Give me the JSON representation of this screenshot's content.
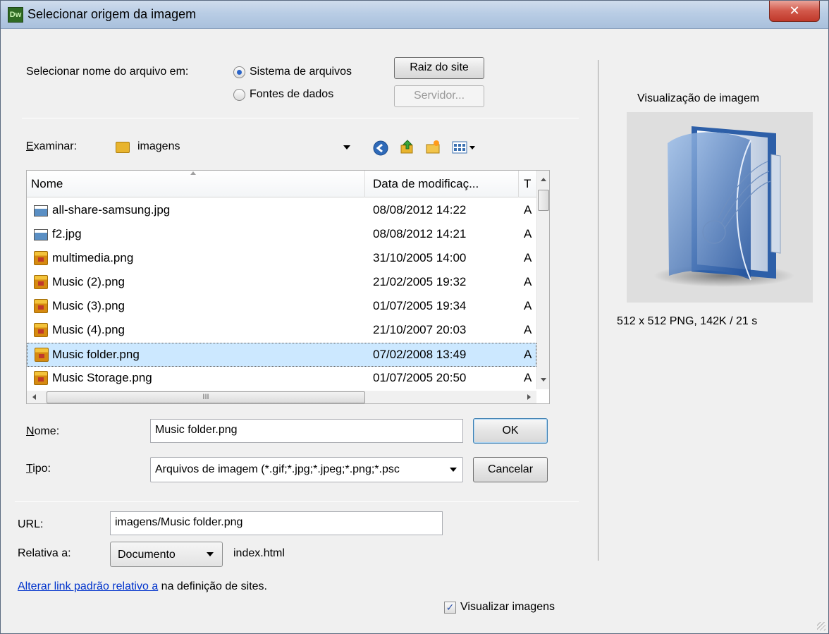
{
  "window": {
    "title": "Selecionar origem da imagem",
    "app_icon_text": "Dw",
    "close_glyph": "✕"
  },
  "source": {
    "label": "Selecionar nome do arquivo em:",
    "options": [
      {
        "label": "Sistema de arquivos",
        "selected": true
      },
      {
        "label": "Fontes de dados",
        "selected": false
      }
    ],
    "site_root_button": "Raiz do site",
    "server_button": "Servidor..."
  },
  "browse": {
    "look_in_label_accel": "E",
    "look_in_label_rest": "xaminar:",
    "folder": "imagens"
  },
  "file_list": {
    "columns": [
      "Nome",
      "Data de modificaç...",
      "T"
    ],
    "rows": [
      {
        "name": "all-share-samsung.jpg",
        "date": "08/08/2012 14:22",
        "type": "A",
        "icon": "jpg-file-icon"
      },
      {
        "name": "f2.jpg",
        "date": "08/08/2012 14:21",
        "type": "A",
        "icon": "jpg-file-icon"
      },
      {
        "name": "multimedia.png",
        "date": "31/10/2005 14:00",
        "type": "A",
        "icon": "png-file-icon"
      },
      {
        "name": "Music (2).png",
        "date": "21/02/2005 19:32",
        "type": "A",
        "icon": "png-file-icon"
      },
      {
        "name": "Music (3).png",
        "date": "01/07/2005 19:34",
        "type": "A",
        "icon": "png-file-icon"
      },
      {
        "name": "Music (4).png",
        "date": "21/10/2007 20:03",
        "type": "A",
        "icon": "png-file-icon"
      },
      {
        "name": "Music folder.png",
        "date": "07/02/2008 13:49",
        "type": "A",
        "icon": "png-file-icon",
        "selected": true
      },
      {
        "name": "Music Storage.png",
        "date": "01/07/2005 20:50",
        "type": "A",
        "icon": "png-file-icon"
      }
    ],
    "hscroll_thumb_grip": "III"
  },
  "filename": {
    "label_accel": "N",
    "label_rest": "ome:",
    "value": "Music folder.png",
    "ok_button": "OK"
  },
  "filetype": {
    "label_accel": "T",
    "label_rest": "ipo:",
    "value": "Arquivos de imagem (*.gif;*.jpg;*.jpeg;*.png;*.psc",
    "cancel_button": "Cancelar"
  },
  "url": {
    "label": "URL:",
    "value": "imagens/Music folder.png"
  },
  "relative": {
    "label": "Relativa a:",
    "value": "Documento",
    "file": "index.html"
  },
  "help": {
    "link_text": "Alterar link padrão relativo a",
    "rest_text": " na definição de sites."
  },
  "preview_images": {
    "label": "Visualizar imagens",
    "checked": true
  },
  "preview": {
    "title": "Visualização de imagem",
    "info": "512 x 512 PNG, 142K / 21 s"
  }
}
